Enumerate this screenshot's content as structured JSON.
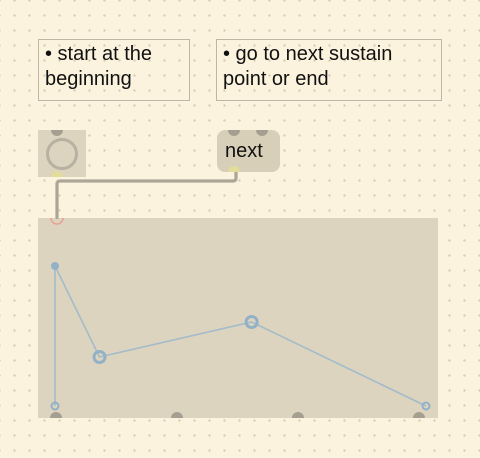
{
  "comments": {
    "start": "• start at the beginning",
    "next": "• go to next sustain point or end"
  },
  "message_box": {
    "label": "next"
  },
  "envelope": {
    "points": [
      {
        "t": 0.0,
        "v": 0.0
      },
      {
        "t": 0.0,
        "v": 1.0,
        "sustain": false
      },
      {
        "t": 0.12,
        "v": 0.35,
        "sustain": true
      },
      {
        "t": 0.53,
        "v": 0.6,
        "sustain": true
      },
      {
        "t": 1.0,
        "v": 0.0,
        "sustain": false
      }
    ],
    "line_color": "#a4bbc9",
    "point_color": "#93b1c6"
  },
  "colors": {
    "background": "#fcf3df",
    "object": "#dcd4bf",
    "patchcord": "#bcb5a4"
  }
}
